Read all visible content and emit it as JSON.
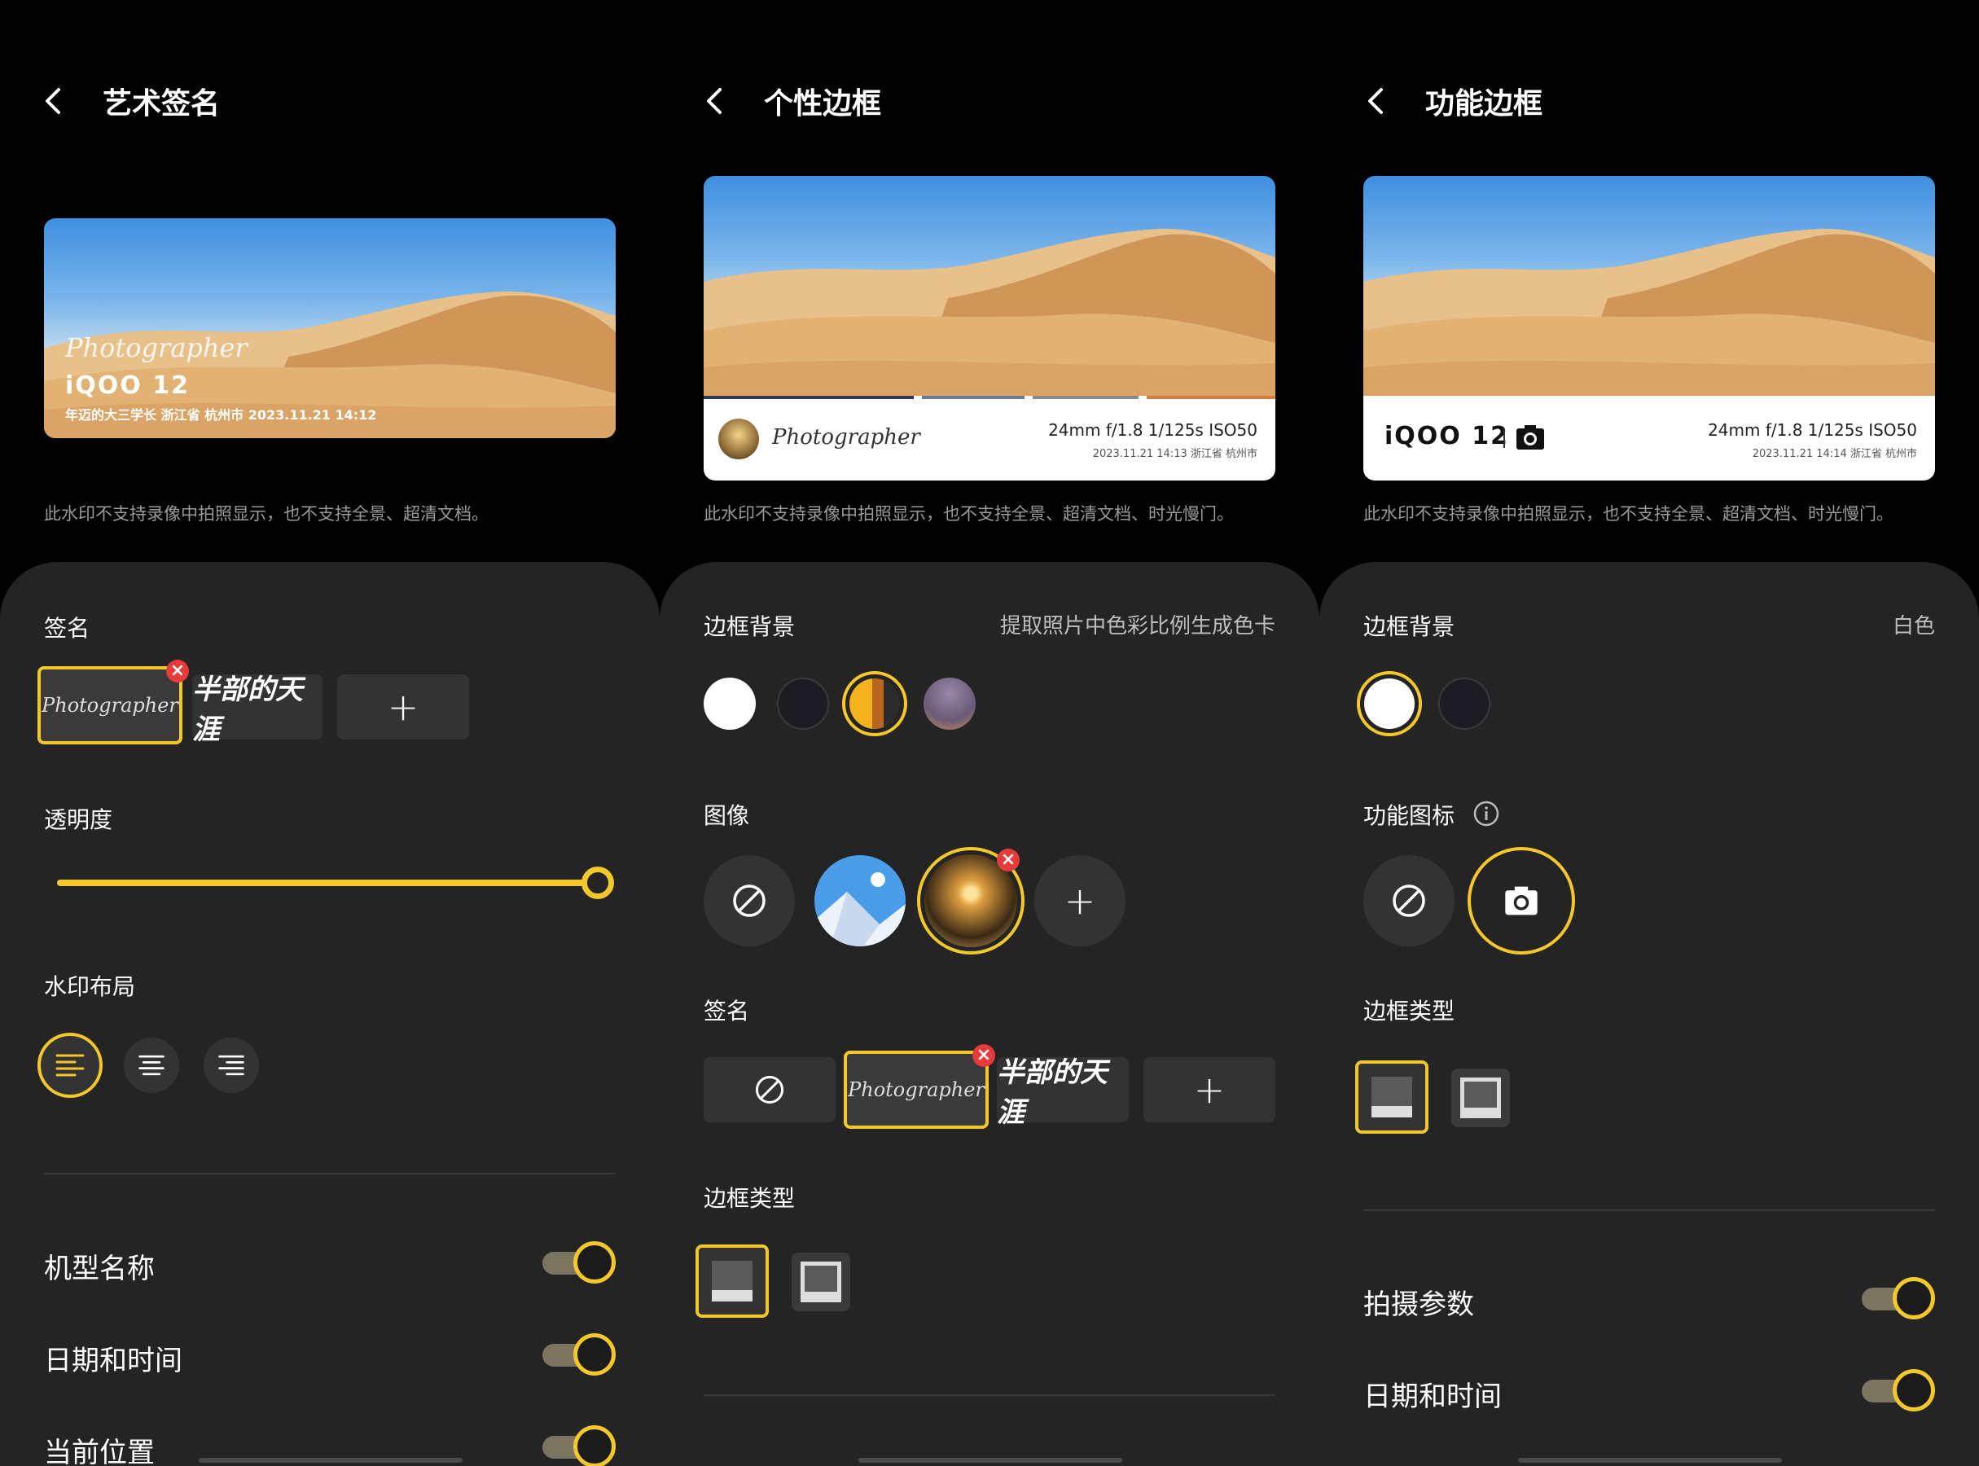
{
  "panel1": {
    "title": "艺术签名",
    "overlay": {
      "signature": "Photographer",
      "model": "iQOO 12",
      "caption": "年迈的大三学长  浙江省 杭州市 2023.11.21 14:12"
    },
    "note": "此水印不支持录像中拍照显示，也不支持全景、超清文档。",
    "signature_label": "签名",
    "signature_options": [
      "Photographer",
      "半部的天涯"
    ],
    "opacity_label": "透明度",
    "opacity_value": 1.0,
    "layout_label": "水印布局",
    "toggles": [
      {
        "label": "机型名称",
        "on": true
      },
      {
        "label": "日期和时间",
        "on": true
      },
      {
        "label": "当前位置",
        "on": true
      }
    ]
  },
  "panel2": {
    "title": "个性边框",
    "frame": {
      "signature": "Photographer",
      "params": "24mm f/1.8 1/125s ISO50",
      "meta": "2023.11.21 14:13  浙江省 杭州市"
    },
    "note": "此水印不支持录像中拍照显示，也不支持全景、超清文档、时光慢门。",
    "bg_label": "边框背景",
    "bg_hint": "提取照片中色彩比例生成色卡",
    "image_label": "图像",
    "signature_label": "签名",
    "signature_options": [
      "Photographer",
      "半部的天涯"
    ],
    "frame_type_label": "边框类型",
    "colors": {
      "white": "#ffffff",
      "black": "#1c1c22",
      "accent": "#f4c82a"
    }
  },
  "panel3": {
    "title": "功能边框",
    "frame": {
      "model": "iQOO 12",
      "params": "24mm f/1.8 1/125s ISO50",
      "meta": "2023.11.21 14:14  浙江省 杭州市"
    },
    "note": "此水印不支持录像中拍照显示，也不支持全景、超清文档、时光慢门。",
    "bg_label": "边框背景",
    "bg_value": "白色",
    "icon_label": "功能图标",
    "frame_type_label": "边框类型",
    "toggles": [
      {
        "label": "拍摄参数",
        "on": true
      },
      {
        "label": "日期和时间",
        "on": true
      }
    ]
  }
}
